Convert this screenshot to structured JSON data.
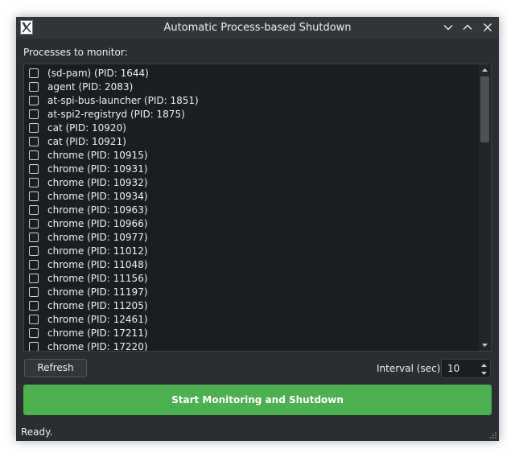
{
  "window": {
    "title": "Automatic Process-based Shutdown"
  },
  "processes": {
    "label": "Processes to monitor:",
    "items": [
      {
        "label": "(sd-pam) (PID: 1644)",
        "checked": false
      },
      {
        "label": "agent (PID: 2083)",
        "checked": false
      },
      {
        "label": "at-spi-bus-launcher (PID: 1851)",
        "checked": false
      },
      {
        "label": "at-spi2-registryd (PID: 1875)",
        "checked": false
      },
      {
        "label": "cat (PID: 10920)",
        "checked": false
      },
      {
        "label": "cat (PID: 10921)",
        "checked": false
      },
      {
        "label": "chrome (PID: 10915)",
        "checked": false
      },
      {
        "label": "chrome (PID: 10931)",
        "checked": false
      },
      {
        "label": "chrome (PID: 10932)",
        "checked": false
      },
      {
        "label": "chrome (PID: 10934)",
        "checked": false
      },
      {
        "label": "chrome (PID: 10963)",
        "checked": false
      },
      {
        "label": "chrome (PID: 10966)",
        "checked": false
      },
      {
        "label": "chrome (PID: 10977)",
        "checked": false
      },
      {
        "label": "chrome (PID: 11012)",
        "checked": false
      },
      {
        "label": "chrome (PID: 11048)",
        "checked": false
      },
      {
        "label": "chrome (PID: 11156)",
        "checked": false
      },
      {
        "label": "chrome (PID: 11197)",
        "checked": false
      },
      {
        "label": "chrome (PID: 11205)",
        "checked": false
      },
      {
        "label": "chrome (PID: 12461)",
        "checked": false
      },
      {
        "label": "chrome (PID: 17211)",
        "checked": false
      },
      {
        "label": "chrome (PID: 17220)",
        "checked": false
      }
    ],
    "scroll_position_fraction": 0.0,
    "visible_fraction": 0.25
  },
  "controls": {
    "refresh_label": "Refresh",
    "interval_label": "Interval (sec):",
    "interval_value": "10",
    "start_label": "Start Monitoring and Shutdown"
  },
  "status": {
    "text": "Ready."
  },
  "icons": {
    "app": "x11-icon",
    "minimize": "chevron-down-icon",
    "maximize": "chevron-up-icon",
    "close": "close-icon"
  },
  "colors": {
    "window_bg": "#2a2e32",
    "list_bg": "#1b1e20",
    "accent_green": "#4caf50",
    "text": "#eff0f1"
  }
}
